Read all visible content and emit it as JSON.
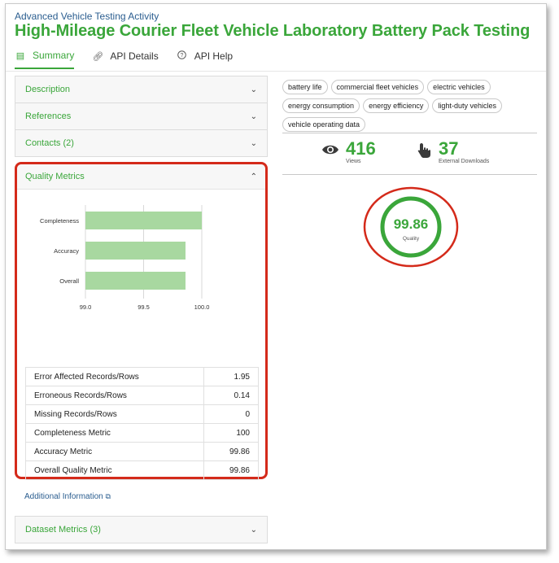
{
  "header": {
    "org": "Advanced Vehicle Testing Activity",
    "title": "High-Mileage Courier Fleet Vehicle Laboratory Battery Pack Testing"
  },
  "tabs": [
    {
      "label": "Summary",
      "icon": "document-icon",
      "active": true
    },
    {
      "label": "API Details",
      "icon": "link-icon",
      "active": false
    },
    {
      "label": "API Help",
      "icon": "help-icon",
      "active": false
    }
  ],
  "accordion": {
    "description": "Description",
    "references": "References",
    "contacts": "Contacts (2)",
    "quality_metrics": "Quality Metrics",
    "dataset_metrics": "Dataset Metrics (3)"
  },
  "chart_data": {
    "type": "bar",
    "orientation": "horizontal",
    "categories": [
      "Completeness",
      "Accuracy",
      "Overall"
    ],
    "values": [
      100.0,
      99.86,
      99.86
    ],
    "xlim": [
      99.0,
      100.0
    ],
    "xticks": [
      "99.0",
      "99.5",
      "100.0"
    ],
    "grid": true,
    "bar_color": "#a8d8a0"
  },
  "metrics_table": [
    {
      "label": "Error Affected Records/Rows",
      "value": "1.95"
    },
    {
      "label": "Erroneous Records/Rows",
      "value": "0.14"
    },
    {
      "label": "Missing Records/Rows",
      "value": "0"
    },
    {
      "label": "Completeness Metric",
      "value": "100"
    },
    {
      "label": "Accuracy Metric",
      "value": "99.86"
    },
    {
      "label": "Overall Quality Metric",
      "value": "99.86"
    }
  ],
  "additional_info": "Additional Information",
  "tags": [
    "battery life",
    "commercial fleet vehicles",
    "electric vehicles",
    "energy consumption",
    "energy efficiency",
    "light-duty vehicles",
    "vehicle operating data"
  ],
  "stats": {
    "views": "416",
    "views_label": "Views",
    "downloads": "37",
    "downloads_label": "External Downloads"
  },
  "quality": {
    "score": "99.86",
    "label": "Quality",
    "fraction": 0.9986
  },
  "colors": {
    "accent": "#3aa63a",
    "link": "#2a5d8f",
    "highlight": "#d42a1a"
  }
}
